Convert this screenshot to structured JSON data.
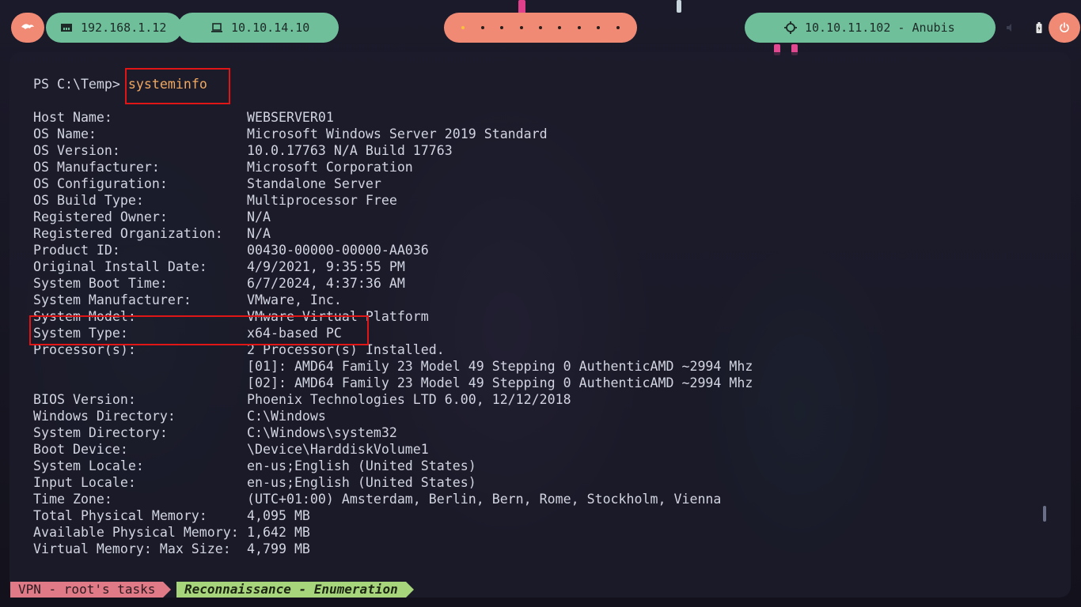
{
  "topbar": {
    "lan_ip": "192.168.1.12",
    "vpn_ip": "10.10.14.10",
    "target": "10.10.11.102 - Anubis",
    "workspace_count": 9,
    "active_workspace": 1,
    "icons": {
      "menu": "kali-dragon-icon",
      "lan": "ethernet-icon",
      "vpn": "laptop-icon",
      "target": "crosshair-icon",
      "volume": "volume-icon",
      "battery": "battery-icon",
      "power": "power-icon"
    }
  },
  "terminal": {
    "prompt": "PS C:\\Temp>",
    "command": "systeminfo",
    "output": [
      {
        "key": "Host Name:",
        "value": "WEBSERVER01"
      },
      {
        "key": "OS Name:",
        "value": "Microsoft Windows Server 2019 Standard"
      },
      {
        "key": "OS Version:",
        "value": "10.0.17763 N/A Build 17763"
      },
      {
        "key": "OS Manufacturer:",
        "value": "Microsoft Corporation"
      },
      {
        "key": "OS Configuration:",
        "value": "Standalone Server"
      },
      {
        "key": "OS Build Type:",
        "value": "Multiprocessor Free"
      },
      {
        "key": "Registered Owner:",
        "value": "N/A"
      },
      {
        "key": "Registered Organization:",
        "value": "N/A"
      },
      {
        "key": "Product ID:",
        "value": "00430-00000-00000-AA036"
      },
      {
        "key": "Original Install Date:",
        "value": "4/9/2021, 9:35:55 PM"
      },
      {
        "key": "System Boot Time:",
        "value": "6/7/2024, 4:37:36 AM"
      },
      {
        "key": "System Manufacturer:",
        "value": "VMware, Inc."
      },
      {
        "key": "System Model:",
        "value": "VMware Virtual Platform"
      },
      {
        "key": "System Type:",
        "value": "x64-based PC"
      },
      {
        "key": "Processor(s):",
        "value": "2 Processor(s) Installed."
      },
      {
        "key": "",
        "value": "[01]: AMD64 Family 23 Model 49 Stepping 0 AuthenticAMD ~2994 Mhz"
      },
      {
        "key": "",
        "value": "[02]: AMD64 Family 23 Model 49 Stepping 0 AuthenticAMD ~2994 Mhz"
      },
      {
        "key": "BIOS Version:",
        "value": "Phoenix Technologies LTD 6.00, 12/12/2018"
      },
      {
        "key": "Windows Directory:",
        "value": "C:\\Windows"
      },
      {
        "key": "System Directory:",
        "value": "C:\\Windows\\system32"
      },
      {
        "key": "Boot Device:",
        "value": "\\Device\\HarddiskVolume1"
      },
      {
        "key": "System Locale:",
        "value": "en-us;English (United States)"
      },
      {
        "key": "Input Locale:",
        "value": "en-us;English (United States)"
      },
      {
        "key": "Time Zone:",
        "value": "(UTC+01:00) Amsterdam, Berlin, Bern, Rome, Stockholm, Vienna"
      },
      {
        "key": "Total Physical Memory:",
        "value": "4,095 MB"
      },
      {
        "key": "Available Physical Memory:",
        "value": "1,642 MB"
      },
      {
        "key": "Virtual Memory: Max Size:",
        "value": "4,799 MB"
      }
    ]
  },
  "statusline": {
    "left": "VPN - root's tasks",
    "right": "Reconnaissance - Enumeration"
  },
  "colors": {
    "highlight": "#e01515",
    "command": "#f0a860",
    "pill_green": "#6fbf9b",
    "pill_orange": "#f08a74"
  }
}
